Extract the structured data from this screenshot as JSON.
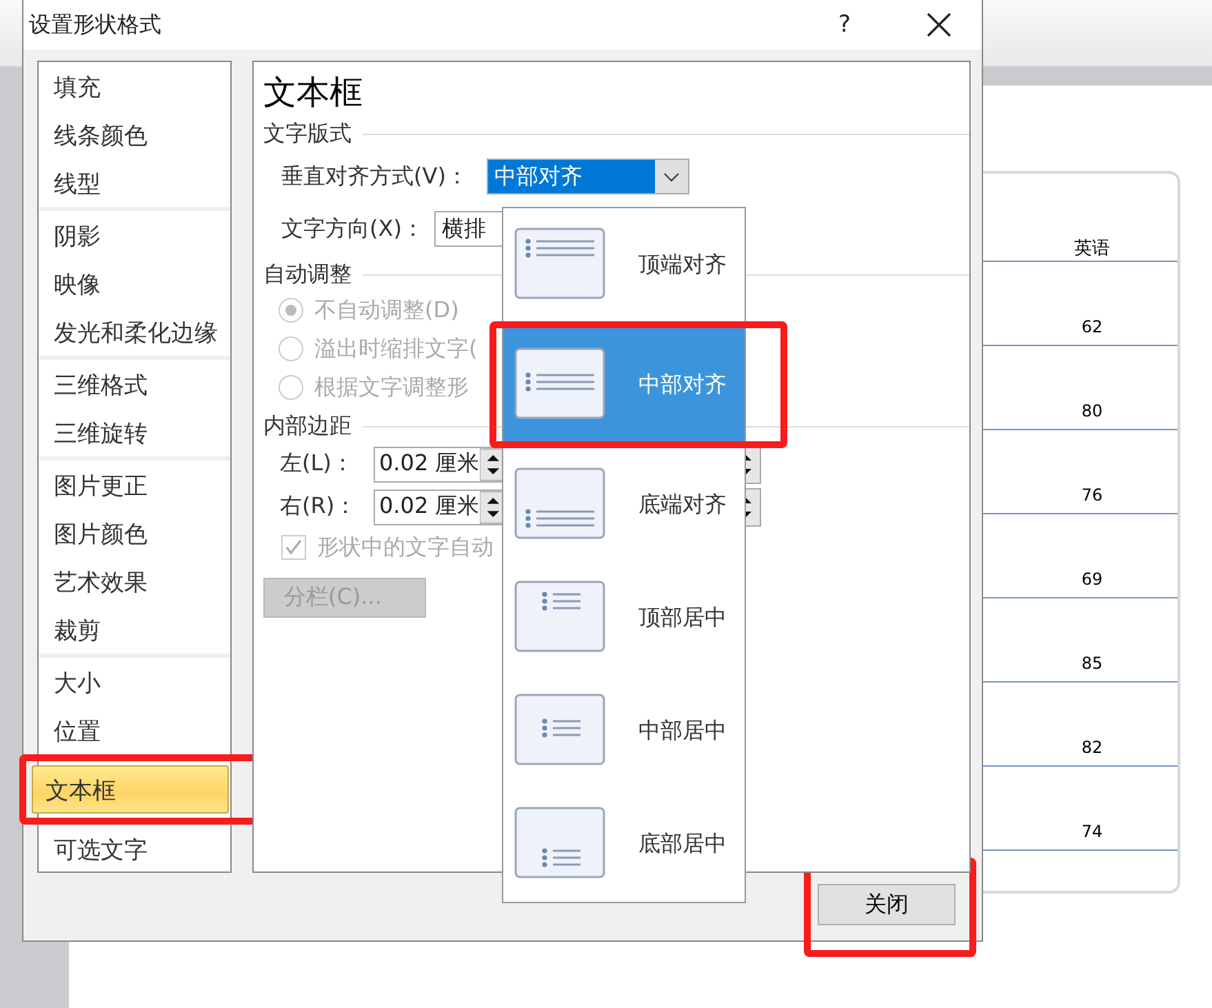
{
  "dialog": {
    "title": "设置形状格式",
    "help": "?"
  },
  "sidebar": {
    "groups": [
      {
        "items": [
          {
            "label": "填充",
            "selected": false
          },
          {
            "label": "线条颜色",
            "selected": false
          },
          {
            "label": "线型",
            "selected": false
          }
        ]
      },
      {
        "items": [
          {
            "label": "阴影",
            "selected": false
          },
          {
            "label": "映像",
            "selected": false
          },
          {
            "label": "发光和柔化边缘",
            "selected": false
          }
        ]
      },
      {
        "items": [
          {
            "label": "三维格式",
            "selected": false
          },
          {
            "label": "三维旋转",
            "selected": false
          }
        ]
      },
      {
        "items": [
          {
            "label": "图片更正",
            "selected": false
          },
          {
            "label": "图片颜色",
            "selected": false
          },
          {
            "label": "艺术效果",
            "selected": false
          },
          {
            "label": "裁剪",
            "selected": false
          }
        ]
      },
      {
        "items": [
          {
            "label": "大小",
            "selected": false
          },
          {
            "label": "位置",
            "selected": false
          },
          {
            "label": "文本框",
            "selected": true
          },
          {
            "label": "可选文字",
            "selected": false
          }
        ]
      }
    ]
  },
  "panel": {
    "title": "文本框",
    "layout_section": "文字版式",
    "vertical_align": {
      "label": "垂直对齐方式(V)：",
      "value": "中部对齐"
    },
    "text_direction": {
      "label": "文字方向(X)：",
      "value": "横排"
    },
    "autofit_section": "自动调整",
    "autofit_options": [
      {
        "label": "不自动调整(D)",
        "selected": true
      },
      {
        "label": "溢出时缩排文字(",
        "selected": false
      },
      {
        "label": "根据文字调整形",
        "selected": false
      }
    ],
    "margin_section": "内部边距",
    "margins": [
      {
        "label": "左(L)：",
        "value": "0.02 厘米"
      },
      {
        "label": "右(R)：",
        "value": "0.02 厘米"
      }
    ],
    "wrap": {
      "label": "形状中的文字自动",
      "checked": true,
      "disabled": true
    },
    "columns_button": {
      "label": "分栏(C)...",
      "disabled": true
    }
  },
  "dropdown": {
    "options": [
      {
        "label": "顶端对齐",
        "selected": false
      },
      {
        "label": "中部对齐",
        "selected": true
      },
      {
        "label": "底端对齐",
        "selected": false
      },
      {
        "label": "顶部居中",
        "selected": false
      },
      {
        "label": "中部居中",
        "selected": false
      },
      {
        "label": "底部居中",
        "selected": false
      }
    ]
  },
  "close_button": "关闭",
  "table": {
    "header": "英语",
    "values": [
      "62",
      "80",
      "76",
      "69",
      "85",
      "82",
      "74"
    ]
  }
}
